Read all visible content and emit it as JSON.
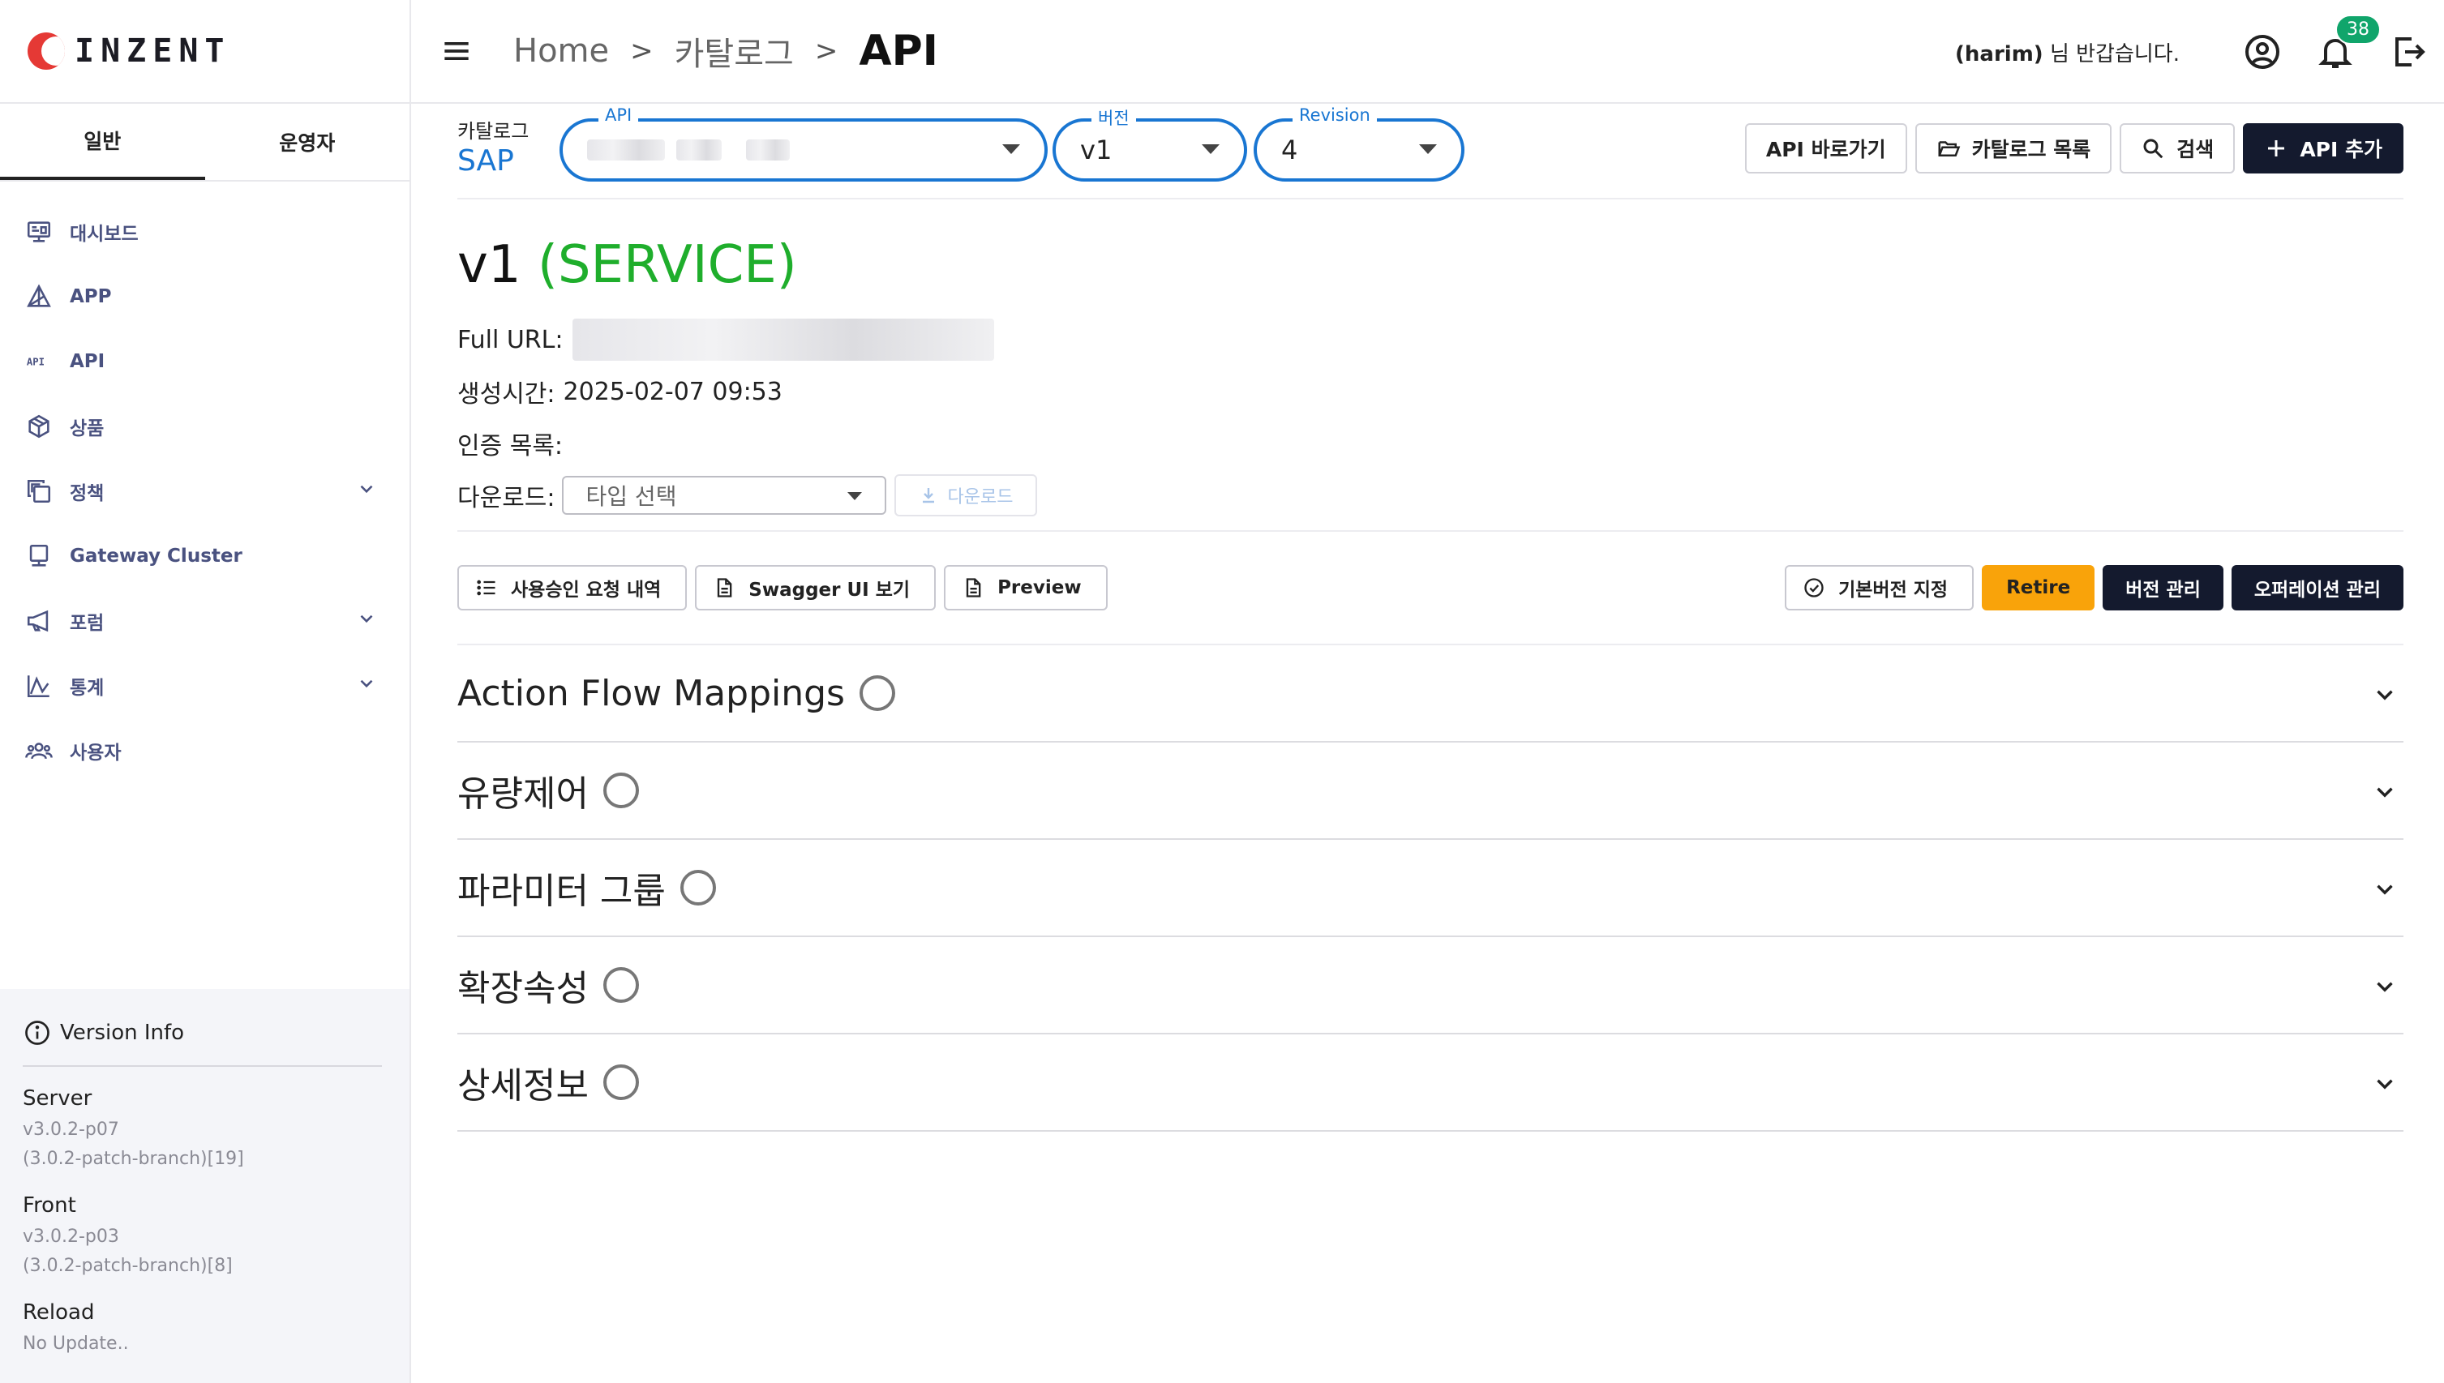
{
  "brand": {
    "name": "INZENT",
    "mark_color": "#e53935"
  },
  "sidebar": {
    "tabs": [
      {
        "label": "일반",
        "active": true
      },
      {
        "label": "운영자",
        "active": false
      }
    ],
    "items": [
      {
        "label": "대시보드",
        "icon": "dashboard-icon"
      },
      {
        "label": "APP",
        "icon": "app-icon"
      },
      {
        "label": "API",
        "icon": "api-icon"
      },
      {
        "label": "상품",
        "icon": "package-icon"
      },
      {
        "label": "정책",
        "icon": "policy-icon",
        "expandable": true
      },
      {
        "label": "Gateway Cluster",
        "icon": "server-icon"
      },
      {
        "label": "포럼",
        "icon": "megaphone-icon",
        "expandable": true
      },
      {
        "label": "통계",
        "icon": "chart-icon",
        "expandable": true
      },
      {
        "label": "사용자",
        "icon": "users-icon"
      }
    ],
    "version_info": {
      "title": "Version Info",
      "server_title": "Server",
      "server_line1": "v3.0.2-p07",
      "server_line2": "(3.0.2-patch-branch)[19]",
      "front_title": "Front",
      "front_line1": "v3.0.2-p03",
      "front_line2": "(3.0.2-patch-branch)[8]",
      "reload_title": "Reload",
      "reload_line": "No Update.."
    }
  },
  "header": {
    "breadcrumb": [
      "Home",
      "카탈로그",
      "API"
    ],
    "separator": ">",
    "user": "(harim)",
    "greeting_suffix": "님 반갑습니다.",
    "notification_count": "38",
    "accent": "#1976d2"
  },
  "toolbar": {
    "catalog_label": "카탈로그",
    "catalog_value": "SAP",
    "api_select_label": "API",
    "version_select_label": "버전",
    "version_value": "v1",
    "revision_select_label": "Revision",
    "revision_value": "4",
    "buttons": {
      "shortcut": "API 바로가기",
      "catalog_list": "카탈로그 목록",
      "search": "검색",
      "add": "API 추가"
    }
  },
  "detail": {
    "version": "v1",
    "type": "(SERVICE)",
    "type_color": "#1fae2c",
    "full_url_label": "Full URL:",
    "created_label": "생성시간:",
    "created_value": "2025-02-07 09:53",
    "auth_label": "인증 목록:",
    "download_label": "다운로드:",
    "download_placeholder": "타입 선택",
    "download_button": "다운로드"
  },
  "actions": {
    "approval_requests": "사용승인 요청 내역",
    "swagger": "Swagger UI 보기",
    "preview": "Preview",
    "set_default": "기본버전 지정",
    "retire": "Retire",
    "version_manage": "버전 관리",
    "operation_manage": "오퍼레이션 관리"
  },
  "sections": [
    "Action Flow Mappings",
    "유량제어",
    "파라미터 그룹",
    "확장속성",
    "상세정보"
  ]
}
